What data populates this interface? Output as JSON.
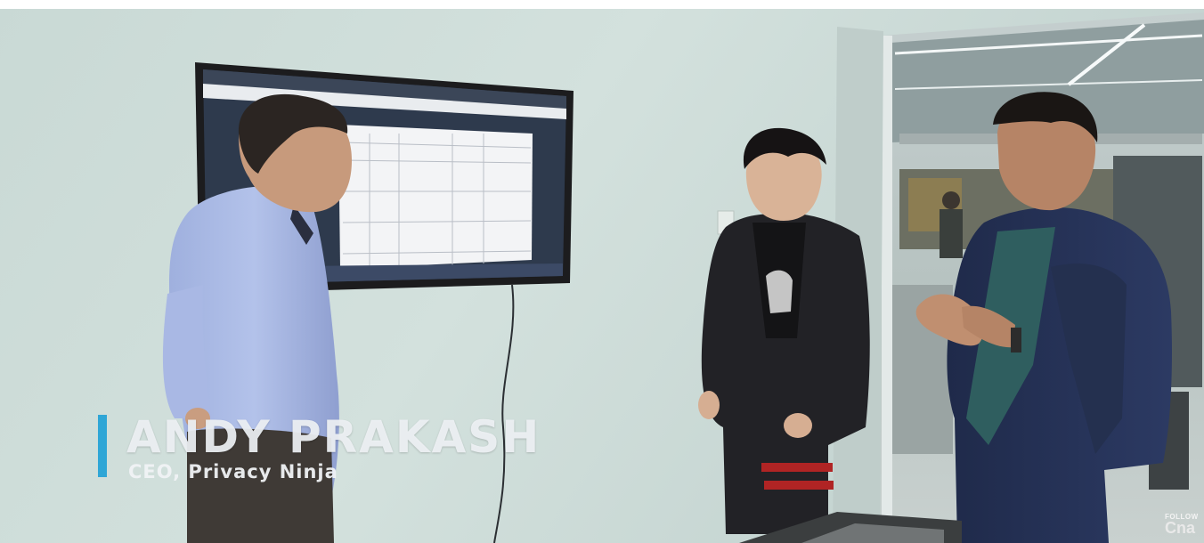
{
  "video": {
    "lower_third": {
      "name": "ANDY PRAKASH",
      "title": "CEO, Privacy Ninja",
      "accent_color": "#2fa6d6"
    },
    "watermark": {
      "line1": "FOLLOW",
      "line2": "Cna"
    }
  }
}
